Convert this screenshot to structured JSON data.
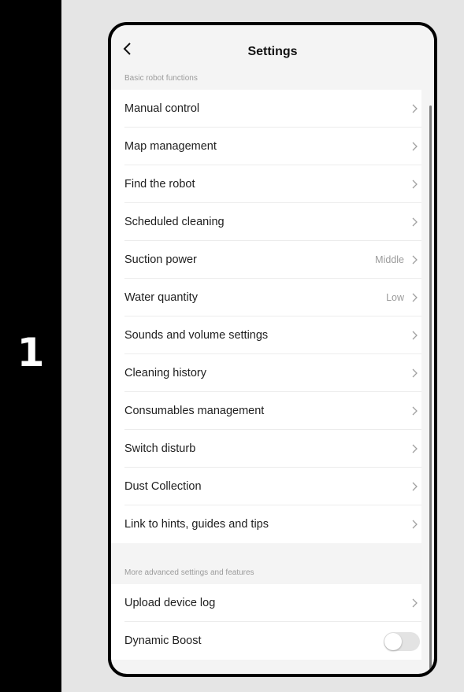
{
  "step": "1",
  "header": {
    "title": "Settings",
    "back_icon": "chevron-left-icon"
  },
  "sections": [
    {
      "label": "Basic robot functions",
      "items": [
        {
          "label": "Manual control",
          "value": ""
        },
        {
          "label": "Map management",
          "value": ""
        },
        {
          "label": "Find the robot",
          "value": ""
        },
        {
          "label": "Scheduled cleaning",
          "value": ""
        },
        {
          "label": "Suction power",
          "value": "Middle"
        },
        {
          "label": "Water quantity",
          "value": "Low"
        },
        {
          "label": "Sounds and volume settings",
          "value": ""
        },
        {
          "label": "Cleaning history",
          "value": ""
        },
        {
          "label": "Consumables management",
          "value": ""
        },
        {
          "label": "Switch disturb",
          "value": ""
        },
        {
          "label": "Dust Collection",
          "value": ""
        },
        {
          "label": "Link to hints, guides and tips",
          "value": ""
        }
      ]
    },
    {
      "label": "More advanced settings and features",
      "items": [
        {
          "label": "Upload device log",
          "value": ""
        },
        {
          "label": "Dynamic Boost",
          "toggle": false
        }
      ]
    }
  ]
}
